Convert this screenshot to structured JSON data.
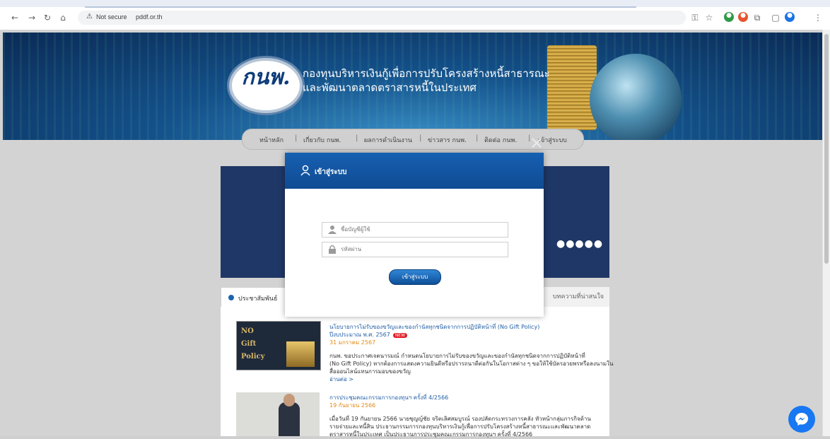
{
  "browser": {
    "security_label": "Not secure",
    "url": "pddf.or.th"
  },
  "banner": {
    "logo_text": "กนพ.",
    "org_line1": "กองทุนบริหารเงินกู้เพื่อการปรับโครงสร้างหนี้สาธารณะ",
    "org_line2": "และพัฒนาตลาดตราสารหนี้ในประเทศ"
  },
  "nav": {
    "items": [
      {
        "label": "หน้าหลัก"
      },
      {
        "label": "เกี่ยวกับ กนพ."
      },
      {
        "label": "ผลการดำเนินงาน"
      },
      {
        "label": "ข่าวสาร กนพ."
      },
      {
        "label": "ติดต่อ กนพ."
      },
      {
        "label": "เข้าสู่ระบบ"
      }
    ]
  },
  "tabs": {
    "news": "ประชาสัมพันธ์",
    "articles": "บทความที่น่าสนใจ"
  },
  "news": {
    "items": [
      {
        "thumb_lines": [
          "NO",
          "Gift",
          "Policy"
        ],
        "title_line1": "นโยบายการไม่รับของขวัญและของกำนัลทุกชนิดจากการปฏิบัติหน้าที่ (No Gift Policy)",
        "title_line2": "ปีงบประมาณ พ.ศ. 2567",
        "badge": "NEW",
        "date": "31 มกราคม 2567",
        "body_line1": "กนพ. ขอประกาศเจตนารมณ์ กำหนดนโยบายการไม่รับของขวัญและของกำนัลทุกชนิดจากการปฏิบัติหน้าที่",
        "body_line2": "(No Gift Policy) หากต้องการแสดงความยินดีหรือปรารถนาดีต่อกันในโอกาสต่าง ๆ ขอให้ใช้บัตรอวยพรหรือลงนามใน",
        "body_line3": "สื่อออนไลน์แทนการมอบของขวัญ",
        "more": "อ่านต่อ >"
      },
      {
        "title_line1": "การประชุมคณะกรรมการกองทุนฯ ครั้งที่ 4/2566",
        "date": "19 กันยายน 2566",
        "body_line1": "เมื่อวันที่ 19 กันยายน 2566 นายชุญญ์ชัย จริตเลิศสมบูรณ์ รองปลัดกระทรวงการคลัง หัวหน้ากลุ่มภารกิจด้าน",
        "body_line2": "รายจ่ายและหนี้สิน ประธานกรรมการกองทุนบริหารเงินกู้เพื่อการปรับโครงสร้างหนี้สาธารณะและพัฒนาตลาด",
        "body_line3": "ตราสารหนี้ในประเทศ เป็นประธานการประชุมคณะกรรมการกองทุนฯ ครั้งที่ 4/2566"
      }
    ]
  },
  "modal": {
    "title": "เข้าสู่ระบบ",
    "username_placeholder": "ชื่อบัญชีผู้ใช้",
    "password_placeholder": "รหัสผ่าน",
    "login_label": "เข้าสู่ระบบ",
    "close_symbol": "✕"
  },
  "slider": {
    "dots": "●●●●●"
  },
  "colors": {
    "modal_header": "#1760b2",
    "menu_bg": "#d0d0d0",
    "slider_bg": "#1f3766",
    "messenger": "#1877f2"
  }
}
